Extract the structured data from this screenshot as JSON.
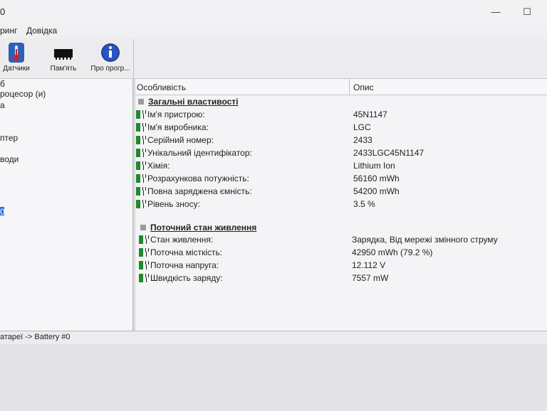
{
  "window": {
    "title": "0",
    "minimize": "—",
    "maximize": "☐"
  },
  "menu": {
    "item1": "ринг",
    "item2": "Довідка"
  },
  "toolbar": {
    "sensors": "Датчики",
    "memory": "Пам'ять",
    "about": "Про прогр..."
  },
  "tree": {
    "t0": "б",
    "t1": "роцесор (и)",
    "t2": "а",
    "t3": "птер",
    "t4": "води",
    "t5": "0"
  },
  "table": {
    "col_feature": "Особливість",
    "col_desc": "Опис",
    "section1": "Загальні властивості",
    "rows1": [
      {
        "prop": "Ім'я пристрою:",
        "val": "45N1147"
      },
      {
        "prop": "Ім'я виробника:",
        "val": "LGC"
      },
      {
        "prop": "Серійний номер:",
        "val": "2433"
      },
      {
        "prop": "Унікальний ідентифікатор:",
        "val": "2433LGC45N1147"
      },
      {
        "prop": "Хімія:",
        "val": "Lithium Ion"
      },
      {
        "prop": "Розрахункова потужність:",
        "val": "56160 mWh"
      },
      {
        "prop": "Повна заряджена ємність:",
        "val": "54200 mWh"
      },
      {
        "prop": "Рівень зносу:",
        "val": "3.5 %"
      }
    ],
    "section2": "Поточний стан живлення",
    "rows2": [
      {
        "prop": "Стан живлення:",
        "val": "Зарядка, Від мережі змінного струму"
      },
      {
        "prop": "Поточна місткість:",
        "val": "42950 mWh (79.2 %)"
      },
      {
        "prop": "Поточна напруга:",
        "val": "12.112 V"
      },
      {
        "prop": "Швидкість заряду:",
        "val": "7557 mW"
      }
    ]
  },
  "status": {
    "path": "атареї -> Battery #0"
  },
  "colors": {
    "battery": "#1f8a2c",
    "accent": "#2a6fd0"
  }
}
